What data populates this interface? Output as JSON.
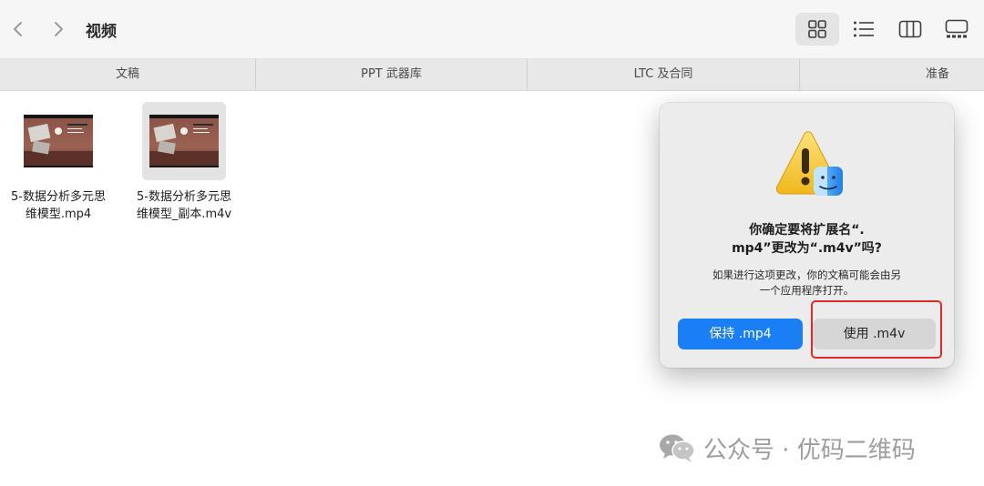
{
  "window": {
    "title": "视频"
  },
  "tabs": [
    {
      "label": "文稿"
    },
    {
      "label": "PPT 武器库"
    },
    {
      "label": "LTC 及合同"
    },
    {
      "label": "准备"
    }
  ],
  "files": [
    {
      "name": "5-数据分析多元思维模型.mp4",
      "line1": "5-数据分析多元思",
      "line2": "维模型.mp4"
    },
    {
      "name": "5-数据分析多元思维模型_副本.m4v",
      "line1": "5-数据分析多元思",
      "line2": "维模型_副本.m4v"
    }
  ],
  "dialog": {
    "title_line1": "你确定要将扩展名“.",
    "title_line2": "mp4”更改为“.m4v”吗?",
    "message_line1": "如果进行这项更改，你的文稿可能会由另",
    "message_line2": "一个应用程序打开。",
    "keep_label": "保持 .mp4",
    "use_label": "使用 .m4v"
  },
  "watermark": {
    "text": "公众号 · 优码二维码"
  },
  "icons": {
    "back": "chevron-left-icon",
    "forward": "chevron-right-icon",
    "icon_view": "grid-icon",
    "list_view": "list-icon",
    "column_view": "columns-icon",
    "gallery_view": "gallery-icon",
    "alert": "warning-finder-icon",
    "watermark": "wechat-icon"
  },
  "colors": {
    "primary_button": "#1a7ff5",
    "highlight": "#e02a2a",
    "toolbar": "#f6f6f6",
    "dialog": "#ececec"
  }
}
